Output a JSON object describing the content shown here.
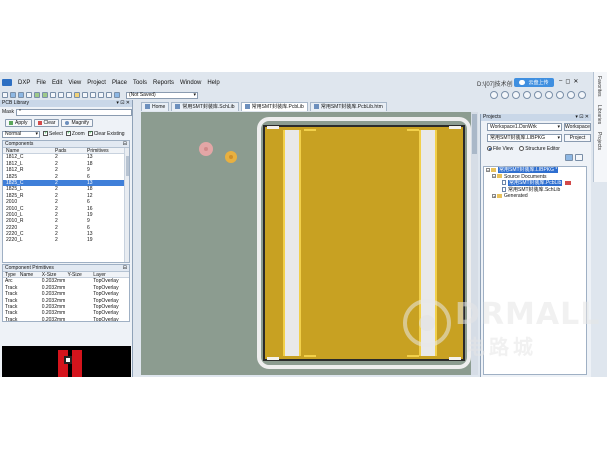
{
  "menubar": {
    "items": [
      "DXP",
      "File",
      "Edit",
      "View",
      "Project",
      "Place",
      "Tools",
      "Reports",
      "Window",
      "Help"
    ],
    "path": "D:\\[07]技术创",
    "badge": "云盘上传"
  },
  "toolbar": {
    "view_select": "(Not Saved)"
  },
  "left_panel": {
    "title": "PCB Library",
    "mask_label": "Mask",
    "mask_value": "*",
    "apply_label": "Apply",
    "clear_label": "Clear",
    "magnify_label": "Magnify",
    "mode_value": "Normal",
    "select_label": "Select",
    "zoom_label": "Zoom",
    "clear_existing_label": "Clear Existing",
    "components": {
      "header": "Components",
      "columns": [
        "Name",
        "Pads",
        "Primitives"
      ],
      "rows": [
        [
          "1812_C",
          "2",
          "13"
        ],
        [
          "1812_L",
          "2",
          "18"
        ],
        [
          "1812_R",
          "2",
          "9"
        ],
        [
          "1825",
          "2",
          "6"
        ],
        [
          "1825_C",
          "2",
          "13"
        ],
        [
          "1825_L",
          "2",
          "18"
        ],
        [
          "1825_R",
          "2",
          "12"
        ],
        [
          "2010",
          "2",
          "6"
        ],
        [
          "2010_C",
          "2",
          "16"
        ],
        [
          "2010_L",
          "2",
          "19"
        ],
        [
          "2010_R",
          "2",
          "9"
        ],
        [
          "2220",
          "2",
          "6"
        ],
        [
          "2220_C",
          "2",
          "13"
        ],
        [
          "2220_L",
          "2",
          "19"
        ]
      ],
      "selected_index": 4
    },
    "primitives": {
      "header": "Component Primitives",
      "columns": [
        "Type",
        "Name",
        "X-Size",
        "Y-Size",
        "Layer"
      ],
      "rows": [
        [
          "Arc",
          "",
          "0.2032mm",
          "",
          "TopOverlay"
        ],
        [
          "Track",
          "",
          "0.2032mm",
          "",
          "TopOverlay"
        ],
        [
          "Track",
          "",
          "0.2032mm",
          "",
          "TopOverlay"
        ],
        [
          "Track",
          "",
          "0.2032mm",
          "",
          "TopOverlay"
        ],
        [
          "Track",
          "",
          "0.2032mm",
          "",
          "TopOverlay"
        ],
        [
          "Track",
          "",
          "0.2032mm",
          "",
          "TopOverlay"
        ],
        [
          "Track",
          "",
          "0.2032mm",
          "",
          "TopOverlay"
        ]
      ]
    }
  },
  "doc_tabs": [
    "Home",
    "常用SMT封装库.SchLib",
    "常用SMT封装库.PcbLib",
    "常用SMT封装库.PcbLib.htm"
  ],
  "active_tab_index": 2,
  "right_panel": {
    "title": "Projects",
    "workspace_value": "Workspace1.DsnWrk",
    "workspace_button": "Workspace",
    "project_value": "常用SMT封装库.LIBPKG",
    "project_button": "Project",
    "file_view_label": "File View",
    "structure_editor_label": "Structure Editor",
    "tree": {
      "root": "常用SMT封装库.LIBPKG *",
      "source_folder": "Source Documents",
      "file1": "常用SMT封装库.PcbLib",
      "file2": "常用SMT封装库.SchLib",
      "generated": "Generated"
    }
  },
  "side_tabs": [
    "Favorites",
    "Libraries",
    "Projects"
  ],
  "watermark": {
    "brand": "DRMALL",
    "subtitle": "电路城"
  }
}
